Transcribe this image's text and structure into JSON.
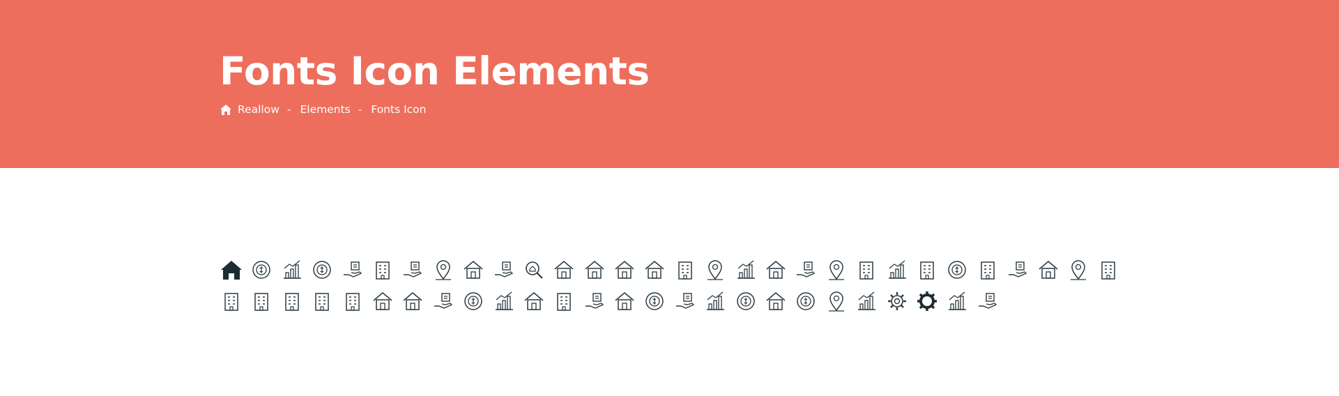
{
  "header": {
    "title": "Fonts Icon Elements",
    "breadcrumb": [
      {
        "label": "Reallow"
      },
      {
        "label": "Elements"
      },
      {
        "label": "Fonts Icon"
      }
    ],
    "separator": "-",
    "background_color": "#ed6e5c"
  },
  "icons": {
    "row1": [
      "home-icon",
      "dollar-coin-icon",
      "investment-growth-icon",
      "idea-bulb-icon",
      "security-camera-icon",
      "mobile-payment-icon",
      "hand-key-icon",
      "location-pin-icon",
      "smart-home-network-icon",
      "hand-house-icon",
      "search-house-icon",
      "house-coin-icon",
      "house-care-icon",
      "house-mortgage-icon",
      "house-for-sale-icon",
      "apartment-building-icon",
      "map-marker-icon",
      "playground-slide-icon",
      "house-interior-icon",
      "office-desk-icon",
      "parking-sign-icon",
      "insured-card-icon",
      "swimming-pool-icon",
      "garden-fence-icon",
      "living-room-lamp-icon",
      "bedroom-bed-icon",
      "dining-table-icon",
      "garage-icon",
      "location-target-icon",
      "tall-building-icon"
    ],
    "row2": [
      "factory-icon",
      "shopping-mall-icon",
      "bank-building-icon",
      "storefront-icon",
      "city-buildings-icon",
      "garage-door-icon",
      "roof-house-icon",
      "hand-document-icon",
      "global-house-icon",
      "team-rating-icon",
      "two-storey-house-icon",
      "building-dollar-icon",
      "hand-coin-icon",
      "cottage-icon",
      "yen-badge-icon",
      "handshake-deal-icon",
      "growth-chart-icon",
      "agent-support-icon",
      "house-tools-icon",
      "money-bag-calculator-icon",
      "map-location-icon",
      "trees-icon",
      "gear-dollar-icon",
      "settings-gear-icon",
      "direction-arrows-icon",
      "hand-idea-icon"
    ]
  }
}
